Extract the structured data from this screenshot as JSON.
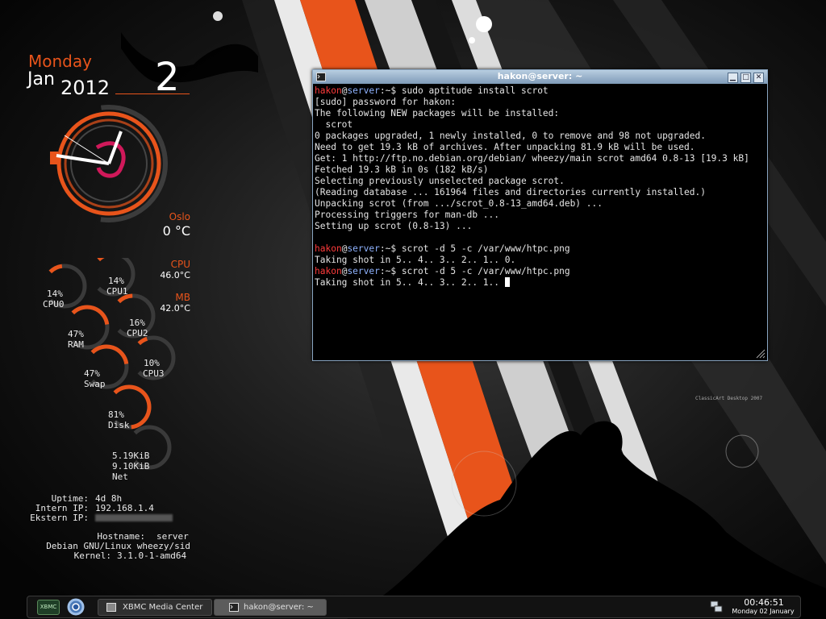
{
  "conky": {
    "date": {
      "day": "Monday",
      "month": "Jan",
      "year": "2012",
      "day_num": "2"
    },
    "weather": {
      "city": "Oslo",
      "temp": "0 °C"
    },
    "sensors": {
      "cpu_label": "CPU",
      "cpu_temp": "46.0°C",
      "mb_label": "MB",
      "mb_temp": "42.0°C"
    },
    "meters": [
      {
        "label": "CPU0",
        "value": "14%",
        "percent": 14
      },
      {
        "label": "CPU1",
        "value": "14%",
        "percent": 14
      },
      {
        "label": "RAM",
        "value": "47%",
        "percent": 47
      },
      {
        "label": "CPU2",
        "value": "16%",
        "percent": 16
      },
      {
        "label": "Swap",
        "value": "47%",
        "percent": 47
      },
      {
        "label": "CPU3",
        "value": "10%",
        "percent": 10
      },
      {
        "label": "Disk",
        "value": "81%",
        "percent": 81
      }
    ],
    "net": {
      "label": "Net",
      "down": "5.19KiB",
      "up": "9.10KiB"
    },
    "system": {
      "uptime_label": "Uptime:",
      "uptime": "4d 8h",
      "intern_label": "Intern IP:",
      "intern_ip": "192.168.1.4",
      "ekstern_label": "Ekstern IP:",
      "hostname_label": "Hostname:",
      "hostname": "server",
      "os": "Debian GNU/Linux wheezy/sid",
      "kernel_label": "Kernel:",
      "kernel": "3.1.0-1-amd64"
    }
  },
  "terminal": {
    "title": "hakon@server: ~",
    "prompt_user": "hakon",
    "prompt_host": "server",
    "prompt_tail": ":~$ ",
    "commands": [
      "sudo aptitude install scrot",
      "scrot -d 5 -c /var/www/htpc.png",
      "scrot -d 5 -c /var/www/htpc.png"
    ],
    "output1": [
      "[sudo] password for hakon:",
      "The following NEW packages will be installed:",
      "  scrot",
      "0 packages upgraded, 1 newly installed, 0 to remove and 98 not upgraded.",
      "Need to get 19.3 kB of archives. After unpacking 81.9 kB will be used.",
      "Get: 1 http://ftp.no.debian.org/debian/ wheezy/main scrot amd64 0.8-13 [19.3 kB]",
      "Fetched 19.3 kB in 0s (182 kB/s)",
      "Selecting previously unselected package scrot.",
      "(Reading database ... 161964 files and directories currently installed.)",
      "Unpacking scrot (from .../scrot_0.8-13_amd64.deb) ...",
      "Processing triggers for man-db ...",
      "Setting up scrot (0.8-13) ..."
    ],
    "output2": "Taking shot in 5.. 4.. 3.. 2.. 1.. 0.",
    "output3": "Taking shot in 5.. 4.. 3.. 2.. 1.. "
  },
  "taskbar": {
    "launcher1": "XBMC",
    "tasks": [
      "XBMC Media Center",
      "hakon@server: ~"
    ],
    "clock_time": "00:46:51",
    "clock_date": "Monday 02 January"
  },
  "wallpaper_credit": "ClassicArt Desktop 2007",
  "colors": {
    "accent": "#e8541b",
    "stripe_orange": "#e8541b",
    "titlebar": "#8aa6c2"
  }
}
